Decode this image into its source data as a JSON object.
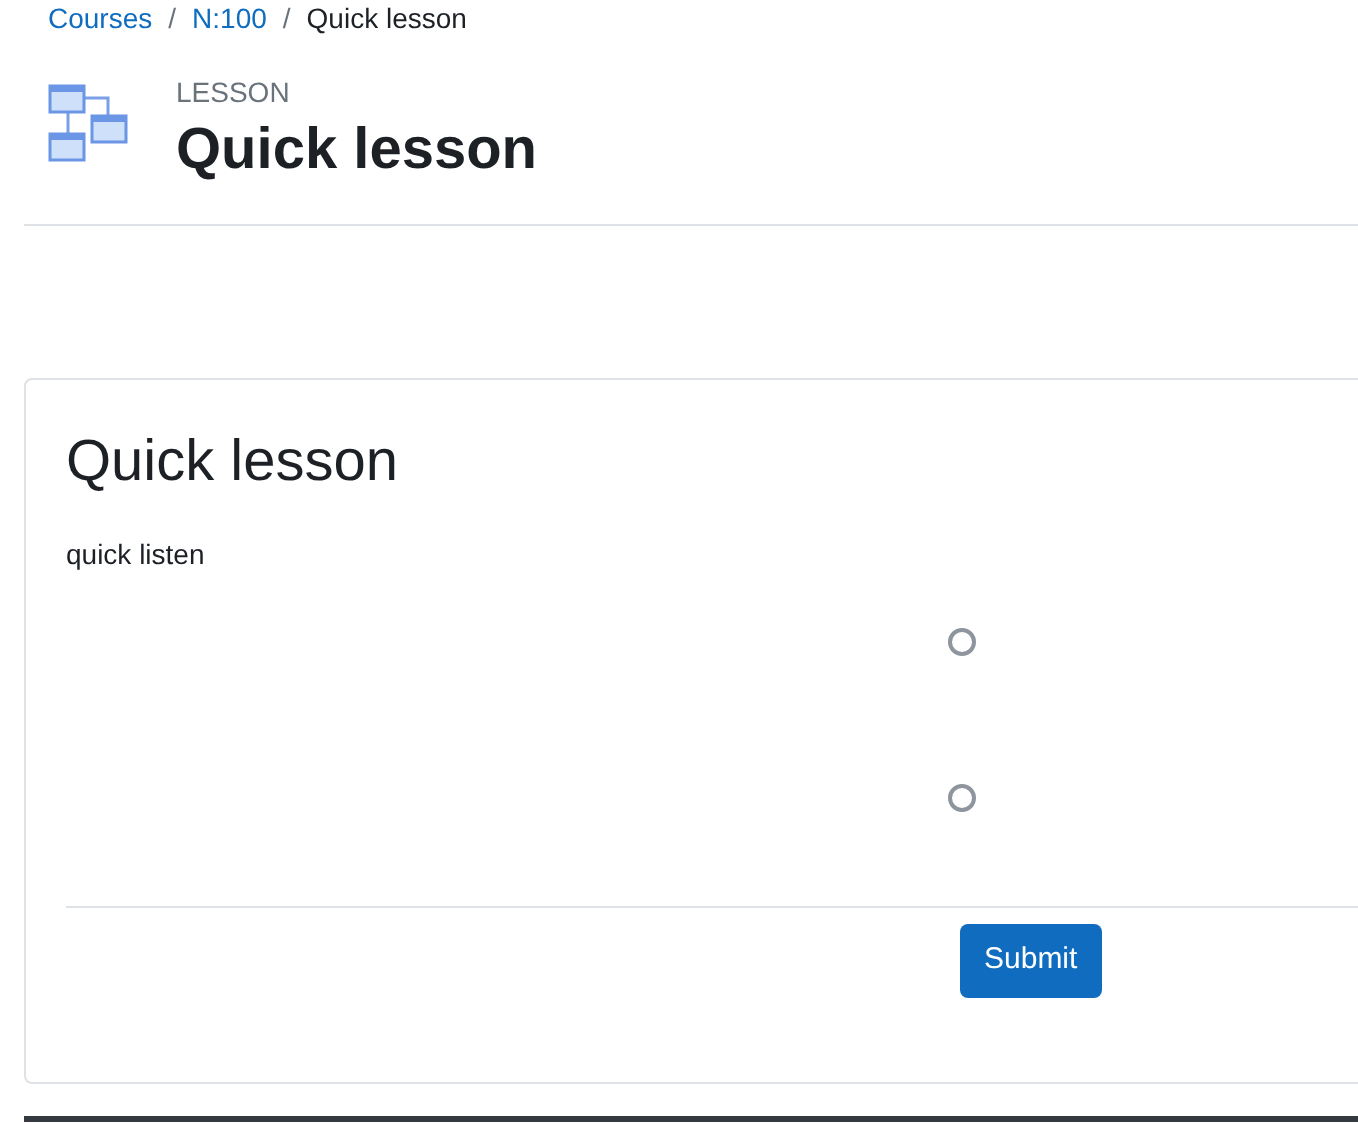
{
  "breadcrumb": [
    {
      "label": "Courses",
      "kind": "link"
    },
    {
      "label": "N:100",
      "kind": "link"
    },
    {
      "label": "Quick lesson",
      "kind": "current"
    }
  ],
  "separator": "/",
  "header": {
    "label": "LESSON",
    "title": "Quick lesson"
  },
  "card": {
    "title": "Quick lesson",
    "text": "quick listen",
    "options": [
      {
        "selected": false
      },
      {
        "selected": false
      }
    ],
    "submit": "Submit"
  }
}
